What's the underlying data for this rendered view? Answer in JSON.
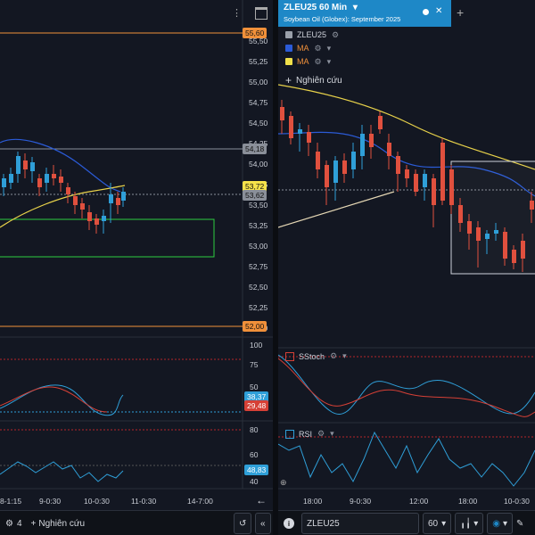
{
  "left": {
    "price_axis": [
      "55,50",
      "55,25",
      "55,00",
      "54,75",
      "54,50",
      "54,25",
      "54,00",
      "53,75",
      "53,50",
      "53,25",
      "53,00",
      "52,75",
      "52,50",
      "52,25",
      "52,00"
    ],
    "price_tags": {
      "high": "55,60",
      "mid": "54,18",
      "last": "53,72",
      "prev": "53,62",
      "low": "52,00"
    },
    "stoch_axis": [
      "100",
      "75",
      "50",
      "25"
    ],
    "stoch_tags": [
      "38,37",
      "29,48"
    ],
    "rsi_axis": [
      "80",
      "60",
      "40"
    ],
    "rsi_tag": "48,83",
    "time_labels": [
      "8-1:15",
      "9-0:30",
      "10-0:30",
      "11-0:30",
      "14-7:00"
    ],
    "toolbar": {
      "count": "4",
      "research_label": "Nghiên cứu"
    }
  },
  "right": {
    "tab": {
      "symbol": "ZLEU25 60 Min",
      "subtitle": "Soybean Oil (Globex): September 2025"
    },
    "legend": [
      {
        "name": "ZLEU25",
        "color": "#9aa0aa"
      },
      {
        "name": "MA",
        "color": "#2b5bd7"
      },
      {
        "name": "MA",
        "color": "#f0e04a"
      }
    ],
    "research_label": "Nghiên cứu",
    "stoch_label": "SStoch",
    "rsi_label": "RSI",
    "time_labels": [
      "18:00",
      "9-0:30",
      "12:00",
      "18:00",
      "10-0:30"
    ],
    "toolbar": {
      "symbol": "ZLEU25",
      "interval": "60"
    }
  },
  "colors": {
    "bg": "#131722",
    "up": "#2f9fd8",
    "down": "#e0503e",
    "accent": "#1e88c7",
    "orange": "#f0903a"
  }
}
